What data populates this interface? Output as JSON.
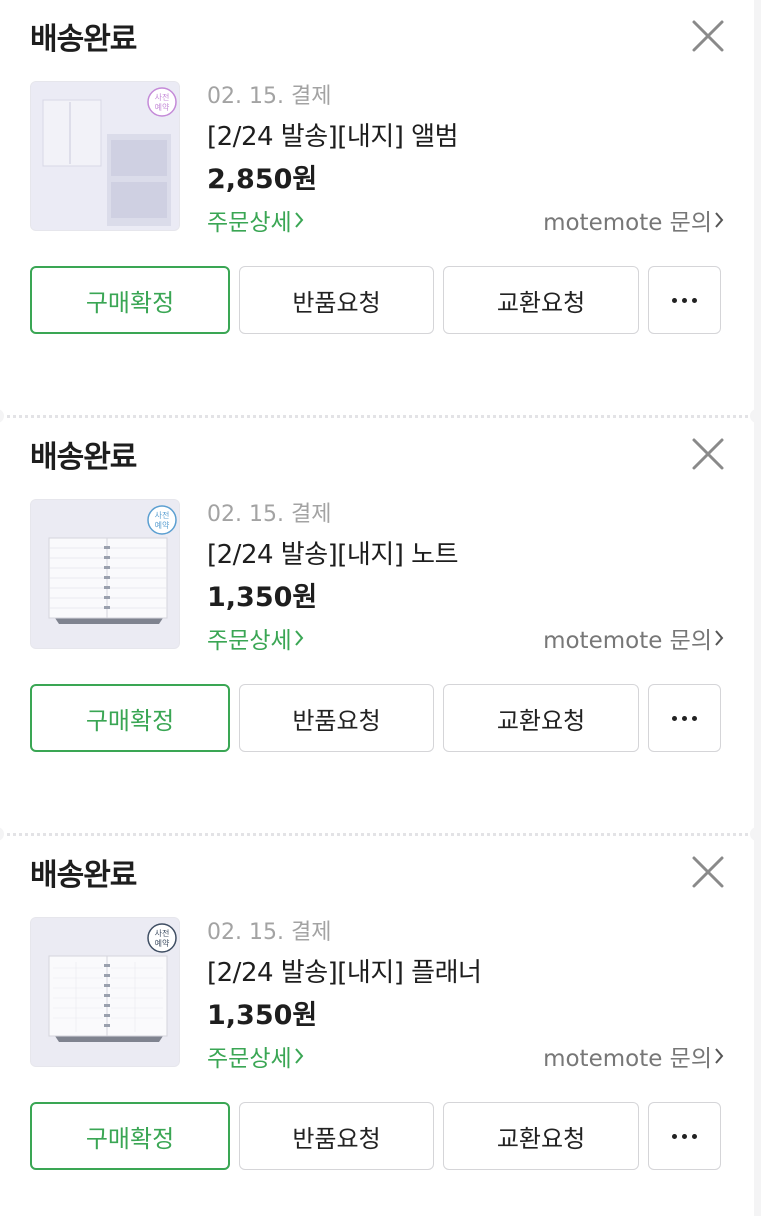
{
  "orders": [
    {
      "status": "배송완료",
      "pay_date": "02. 15. 결제",
      "product_name": "[2/24 발송][내지] 앨범",
      "price": "2,850원",
      "detail_link": "주문상세",
      "inquiry_link": "motemote 문의",
      "badge_line1": "사전",
      "badge_line2": "예약",
      "buttons": {
        "confirm": "구매확정",
        "return": "반품요청",
        "exchange": "교환요청"
      },
      "thumb_type": "album",
      "badge_color": "#c48ad8"
    },
    {
      "status": "배송완료",
      "pay_date": "02. 15. 결제",
      "product_name": "[2/24 발송][내지] 노트",
      "price": "1,350원",
      "detail_link": "주문상세",
      "inquiry_link": "motemote 문의",
      "badge_line1": "사전",
      "badge_line2": "예약",
      "buttons": {
        "confirm": "구매확정",
        "return": "반품요청",
        "exchange": "교환요청"
      },
      "thumb_type": "note",
      "badge_color": "#5b9fd1"
    },
    {
      "status": "배송완료",
      "pay_date": "02. 15. 결제",
      "product_name": "[2/24 발송][내지] 플래너",
      "price": "1,350원",
      "detail_link": "주문상세",
      "inquiry_link": "motemote 문의",
      "badge_line1": "사전",
      "badge_line2": "예약",
      "buttons": {
        "confirm": "구매확정",
        "return": "반품요청",
        "exchange": "교환요청"
      },
      "thumb_type": "planner",
      "badge_color": "#3f4e63"
    }
  ],
  "colors": {
    "accent": "#3aa654",
    "muted": "#a3a3a3"
  },
  "icons": {
    "close": "close-icon",
    "chevron": "chevron-right-icon",
    "more": "more-horizontal-icon"
  }
}
